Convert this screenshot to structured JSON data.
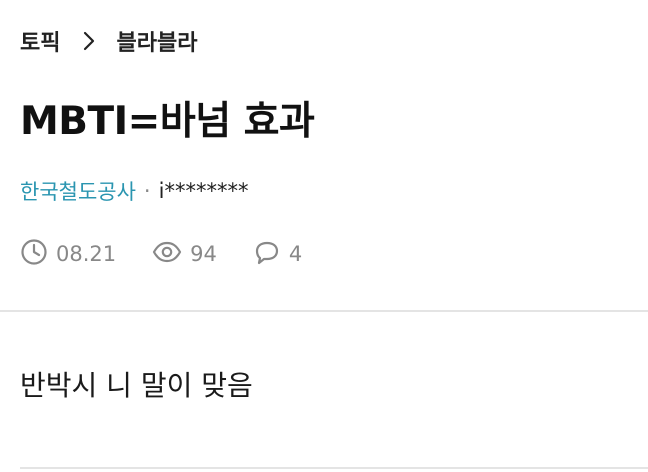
{
  "breadcrumb": {
    "root": "토픽",
    "current": "블라블라"
  },
  "post": {
    "title": "MBTI=바넘 효과",
    "company": "한국철도공사",
    "separator": "·",
    "author": "i********",
    "date": "08.21",
    "views": "94",
    "comments": "4",
    "body": "반박시 니 말이 맞음"
  },
  "icons": {
    "date": "clock-icon",
    "views": "eye-icon",
    "comments": "comment-bubble-icon",
    "breadcrumb": "chevron-right-icon"
  },
  "colors": {
    "company": "#2a95b0",
    "meta": "#888888",
    "divider": "#e4e4e4"
  }
}
